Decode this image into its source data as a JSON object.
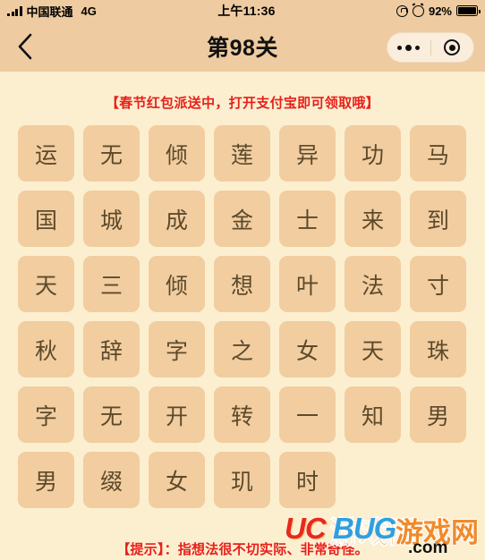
{
  "statusbar": {
    "signal_icon": "signal-bars-icon",
    "carrier": "中国联通",
    "network": "4G",
    "time": "上午11:36",
    "rotation_lock_icon": "rotation-lock-icon",
    "alarm_icon": "alarm-clock-icon",
    "battery_percent": "92%",
    "battery_icon": "battery-full-icon"
  },
  "navbar": {
    "back_icon": "back-chevron-icon",
    "title": "第98关",
    "capsule": {
      "more_icon": "more-dots-icon",
      "target_icon": "target-circle-icon"
    }
  },
  "ad_banner": {
    "text": "【春节红包派送中，打开支付宝即可领取哦】",
    "color": "#e8201b"
  },
  "grid": {
    "columns": 7,
    "tile_color": "#f2cda0",
    "tile_text_color": "#5c4a2b",
    "tiles": [
      "运",
      "无",
      "倾",
      "莲",
      "异",
      "功",
      "马",
      "国",
      "城",
      "成",
      "金",
      "士",
      "来",
      "到",
      "天",
      "三",
      "倾",
      "想",
      "叶",
      "法",
      "寸",
      "秋",
      "辞",
      "字",
      "之",
      "女",
      "天",
      "珠",
      "字",
      "无",
      "开",
      "转",
      "一",
      "知",
      "男",
      "男",
      "缀",
      "女",
      "玑",
      "时"
    ]
  },
  "hint": {
    "text": "【提示】：指想法很不切实际、非常奇怪。",
    "color": "#e8201b"
  },
  "watermark": {
    "uc": "UC",
    "bug": "BUG",
    "cn": "游戏网",
    "domain": ".com"
  },
  "colors": {
    "page_background": "#fbefd0",
    "bar_background": "#eecba0",
    "capsule_background": "#faeddc"
  }
}
